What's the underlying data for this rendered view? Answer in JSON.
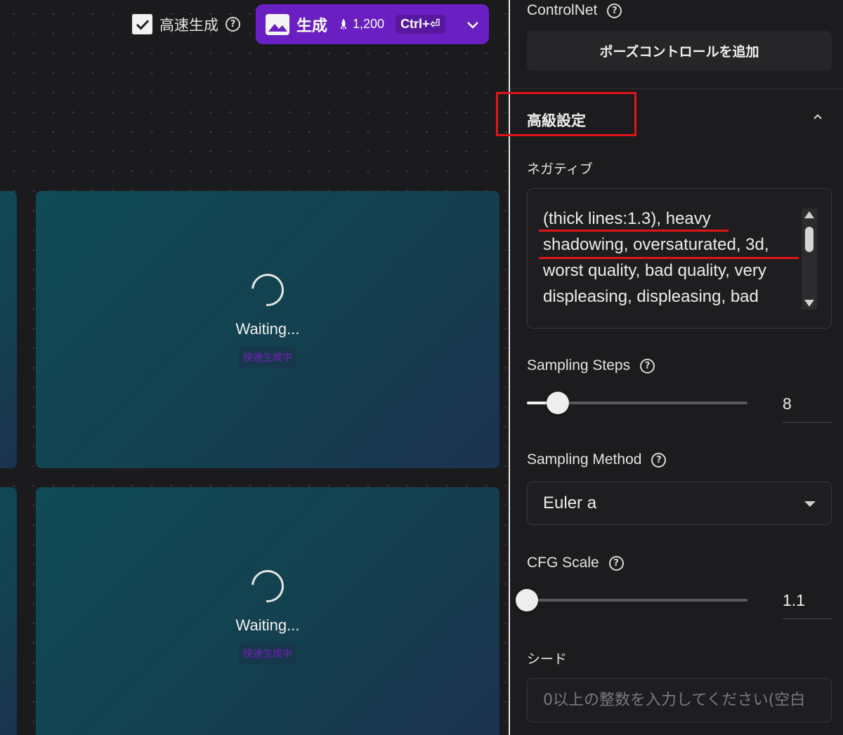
{
  "topbar": {
    "fast_label": "高速生成",
    "fast_checked": true,
    "generate_label": "生成",
    "cost": "1,200",
    "shortcut": "Ctrl+⏎"
  },
  "cards": [
    {
      "status": "Waiting...",
      "badge": "快速生成中"
    },
    {
      "status": "Waiting...",
      "badge": "快速生成中"
    }
  ],
  "panel": {
    "controlnet_label": "ControlNet",
    "pose_button": "ポーズコントロールを追加",
    "advanced_title": "高級設定",
    "negative_label": "ネガティブ",
    "negative_lines": [
      "(thick lines:1.3), heavy",
      "shadowing, oversaturated, 3d,",
      "worst quality, bad quality, very",
      "displeasing, displeasing, bad"
    ],
    "steps_label": "Sampling Steps",
    "steps_value": "8",
    "steps_fraction": 0.14,
    "method_label": "Sampling Method",
    "method_value": "Euler a",
    "cfg_label": "CFG Scale",
    "cfg_value": "1.1",
    "cfg_fraction": 0.0,
    "seed_label": "シード",
    "seed_placeholder": "0以上の整数を入力してください(空白"
  },
  "colors": {
    "accent_purple": "#6a1fc2",
    "highlight_red": "#e0141b",
    "card_teal": "#0f4a56"
  }
}
